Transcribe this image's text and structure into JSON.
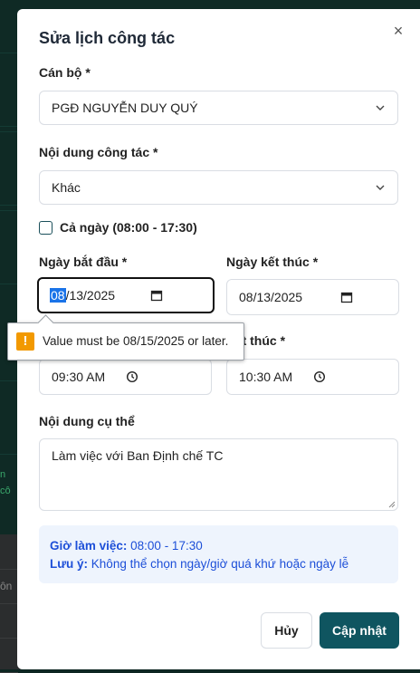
{
  "modal": {
    "title": "Sửa lịch công tác",
    "close_icon": "×"
  },
  "form": {
    "officer": {
      "label": "Cán bộ *",
      "value": "PGĐ NGUYỄN DUY QUÝ"
    },
    "work_content": {
      "label": "Nội dung công tác *",
      "value": "Khác"
    },
    "all_day": {
      "label": "Cả ngày (08:00 - 17:30)",
      "checked": false
    },
    "start_date": {
      "label": "Ngày bắt đầu *",
      "month": "08",
      "rest": "/13/2025"
    },
    "end_date": {
      "label": "Ngày kết thúc *",
      "value": "08/13/2025"
    },
    "start_time": {
      "value": "09:30 AM"
    },
    "end_time": {
      "label_partial": "kết thúc *",
      "value": "10:30 AM"
    },
    "detail": {
      "label": "Nội dung cụ thể",
      "value": "Làm việc với Ban Định chế TC"
    }
  },
  "info": {
    "hours_label": "Giờ làm việc:",
    "hours_value": "08:00 - 17:30",
    "note_label": "Lưu ý:",
    "note_value": "Không thể chọn ngày/giờ quá khứ hoặc ngày lễ"
  },
  "buttons": {
    "cancel": "Hủy",
    "update": "Cập nhật"
  },
  "tooltip": {
    "icon": "!",
    "message": "Value must be 08/15/2025 or later."
  },
  "background": {
    "left_text_1": "ôn",
    "left_green_1": "n",
    "left_green_2": "cô"
  },
  "colors": {
    "primary": "#0f5560",
    "info_bg": "#eef4fd",
    "info_text": "#1d4fd8",
    "warn": "#f29900"
  }
}
